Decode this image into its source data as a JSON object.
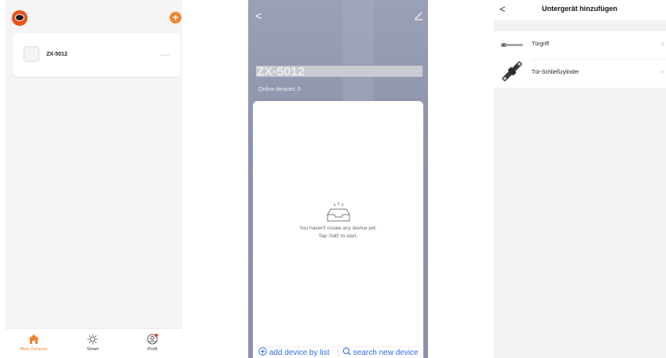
{
  "screen1": {
    "device_name": "ZX-5012",
    "more": "...",
    "add_icon": "+",
    "tabs": [
      {
        "label": "Mein Zuhause",
        "icon": "home-icon"
      },
      {
        "label": "Smart",
        "icon": "sun-icon"
      },
      {
        "label": "Profil",
        "icon": "profile-icon"
      }
    ],
    "accent": "#f0862c"
  },
  "screen2": {
    "back": "<",
    "home_name": "ZX-5012",
    "online_devices": "Online devices: 0",
    "empty_line1": "You haven't create any device yet.",
    "empty_line2": "Tap 'Add' to start.",
    "add_by_list": "add device by list",
    "search_new": "search new device",
    "link_color": "#2f6ee6"
  },
  "screen3": {
    "back": "<",
    "title": "Untergerät hinzufügen",
    "items": [
      {
        "label": "Türgriff",
        "icon": "door-handle-icon"
      },
      {
        "label": "Tür-Schließzylinder",
        "icon": "lock-cylinder-icon"
      }
    ],
    "chevron": ">"
  }
}
